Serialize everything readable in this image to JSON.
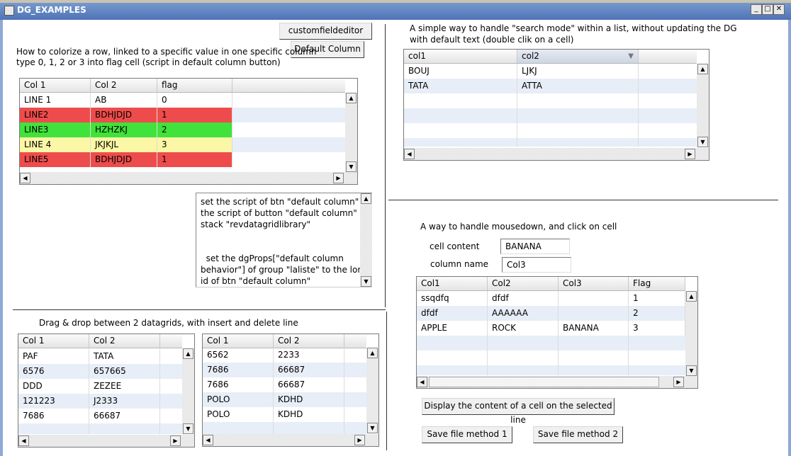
{
  "window": {
    "title": "DG_EXAMPLES"
  },
  "colorize": {
    "customfieldeditor_label": "customfieldeditor",
    "default_column_label": "Default Column",
    "desc_line1": "How to colorize a row, linked to a specific value in one specific column",
    "desc_line2": "type 0, 1, 2 or 3 into flag cell (script in default column button)",
    "headers": [
      "Col 1",
      "Col 2",
      "flag"
    ],
    "rows": [
      {
        "c1": "LINE 1",
        "c2": "AB",
        "c3": "0"
      },
      {
        "c1": "LINE2",
        "c2": "BDHJDJD",
        "c3": "1"
      },
      {
        "c1": "LINE3",
        "c2": "HZHZKJ",
        "c3": "2"
      },
      {
        "c1": "LINE 4",
        "c2": "JKJKJL",
        "c3": "3"
      },
      {
        "c1": "LINE5",
        "c2": "BDHJDJD",
        "c3": "1"
      }
    ],
    "row_colors": {
      "red": "#ee4c4c",
      "green": "#41e23b",
      "yellow": "#fbf7a6"
    }
  },
  "script_box": {
    "p1_l1": "set the script of btn \"default column\" to",
    "p1_l2": "the script of button \"default column\" of",
    "p1_l3": "stack \"revdatagridlibrary\"",
    "p2_l1": "  set the dgProps[\"default column",
    "p2_l2": "behavior\"] of group \"laliste\" to the long",
    "p2_l3": "id of btn \"default column\""
  },
  "search": {
    "desc_line1": "A simple way to handle \"search mode\" within a list, without updating the DG",
    "desc_line2": "with default text (double clik on a cell)",
    "headers": [
      "col1",
      "col2"
    ],
    "rows": [
      {
        "c1": "BOUJ",
        "c2": "LJKJ"
      },
      {
        "c1": "TATA",
        "c2": "ATTA"
      }
    ]
  },
  "mousedown": {
    "desc": "A way to handle mousedown, and click on cell",
    "cell_content_label": "cell content",
    "cell_content_value": "BANANA",
    "column_name_label": "column name",
    "column_name_value": "Col3",
    "headers": [
      "Col1",
      "Col2",
      "Col3",
      "Flag"
    ],
    "rows": [
      {
        "c1": "ssqdfq",
        "c2": "dfdf",
        "c3": "",
        "c4": "1"
      },
      {
        "c1": "dfdf",
        "c2": "AAAAAA",
        "c3": "",
        "c4": "2"
      },
      {
        "c1": "APPLE",
        "c2": "ROCK",
        "c3": "BANANA",
        "c4": "3"
      }
    ],
    "display_button": "Display the content of a cell on the selected line",
    "save1_button": "Save file method 1",
    "save2_button": "Save file method 2"
  },
  "dragdrop": {
    "desc": "Drag & drop between 2 datagrids, with insert and delete line",
    "left_headers": [
      "Col 1",
      "Col 2"
    ],
    "left_rows": [
      {
        "c1": "PAF",
        "c2": "TATA"
      },
      {
        "c1": "6576",
        "c2": "657665"
      },
      {
        "c1": "DDD",
        "c2": "ZEZEE"
      },
      {
        "c1": "121223",
        "c2": "J2333"
      },
      {
        "c1": "7686",
        "c2": "66687"
      }
    ],
    "right_headers": [
      "Col 1",
      "Col 2"
    ],
    "right_rows": [
      {
        "c1": "6562",
        "c2": "2233"
      },
      {
        "c1": "7686",
        "c2": "66687"
      },
      {
        "c1": "7686",
        "c2": "66687"
      },
      {
        "c1": "POLO",
        "c2": "KDHD"
      },
      {
        "c1": "POLO",
        "c2": "KDHD"
      }
    ]
  }
}
